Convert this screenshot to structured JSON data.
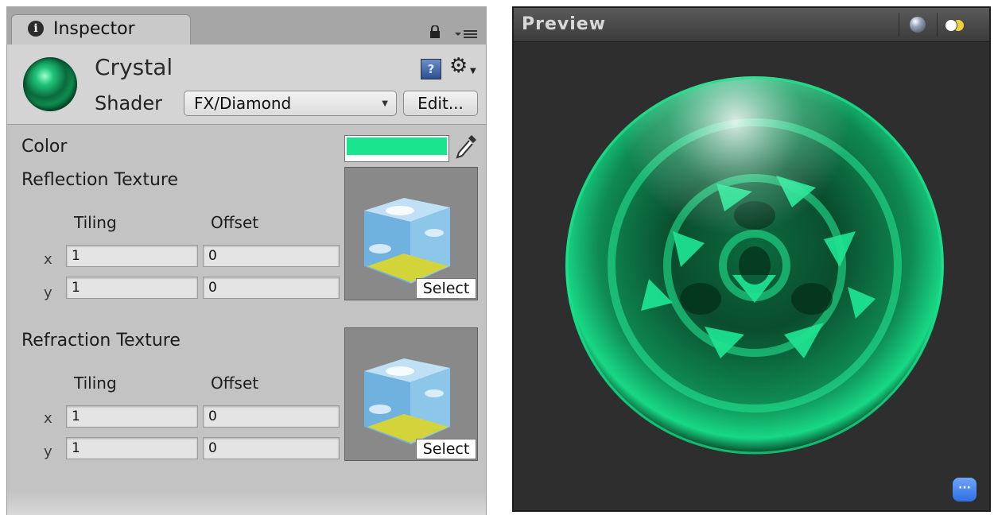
{
  "inspector": {
    "tab_label": "Inspector",
    "material": {
      "name": "Crystal",
      "shader_label": "Shader",
      "shader_value": "FX/Diamond",
      "edit_label": "Edit..."
    },
    "properties": {
      "color_label": "Color",
      "color_value": "#18e58e",
      "reflection": {
        "label": "Reflection Texture",
        "tiling_label": "Tiling",
        "offset_label": "Offset",
        "x_label": "x",
        "y_label": "y",
        "tiling_x": "1",
        "tiling_y": "1",
        "offset_x": "0",
        "offset_y": "0",
        "select_label": "Select"
      },
      "refraction": {
        "label": "Refraction Texture",
        "tiling_label": "Tiling",
        "offset_label": "Offset",
        "x_label": "x",
        "y_label": "y",
        "tiling_x": "1",
        "tiling_y": "1",
        "offset_x": "0",
        "offset_y": "0",
        "select_label": "Select"
      }
    },
    "icons": [
      "info-icon",
      "lock-icon",
      "menu-icon",
      "help-icon",
      "gear-icon",
      "eyedropper-icon",
      "skybox-cube-icon"
    ]
  },
  "preview": {
    "title": "Preview",
    "icons": [
      "sphere-preview-icon",
      "light-toggle-icon",
      "more-options-icon"
    ]
  }
}
